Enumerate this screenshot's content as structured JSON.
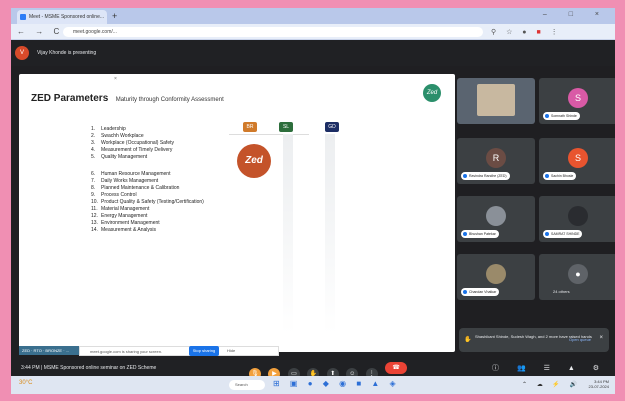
{
  "browser": {
    "tab_title": "Meet - MSME Sponsored online...",
    "new_tab": "+",
    "window_controls": "– □ ×",
    "nav": "← → C",
    "url": "meet.google.com/..."
  },
  "meet": {
    "presenter_initials": "Vijay",
    "presenting_text": "Vijay Khonde is presenting"
  },
  "slide": {
    "title": "ZED Parameters",
    "subtitle": "Maturity through Conformity Assessment",
    "logo_text": "Zed",
    "badges": [
      "BR",
      "SL",
      "GD"
    ],
    "cross": "×",
    "parameters_group1": [
      {
        "num": "1.",
        "label": "Leadership"
      },
      {
        "num": "2.",
        "label": "Swachh Workplace"
      },
      {
        "num": "3.",
        "label": "Workplace (Occupational) Safety"
      },
      {
        "num": "4.",
        "label": "Measurement of Timely Delivery"
      },
      {
        "num": "5.",
        "label": "Quality Management"
      }
    ],
    "parameters_group2": [
      {
        "num": "6.",
        "label": "Human Resource Management"
      },
      {
        "num": "7.",
        "label": "Daily Works Management"
      },
      {
        "num": "8.",
        "label": "Planned Maintenance & Calibration"
      },
      {
        "num": "9.",
        "label": "Process Control"
      },
      {
        "num": "10.",
        "label": "Product Quality & Safety (Testing/Certification)"
      },
      {
        "num": "11.",
        "label": "Material Management"
      },
      {
        "num": "12.",
        "label": "Energy Management"
      },
      {
        "num": "13.",
        "label": "Environment Management"
      },
      {
        "num": "14.",
        "label": "Measurement & Analysis"
      }
    ],
    "share_text": "meet.google.com is sharing your screen.",
    "stop_sharing": "Stop sharing",
    "hide": "Hide",
    "tag": "ZED · RTO · BRONZE · ..."
  },
  "participants": [
    {
      "name": "",
      "initial": "",
      "color": "#5a6470",
      "kind": "photo"
    },
    {
      "name": "Somnath Shinde",
      "initial": "S",
      "color": "#d95aa6",
      "kind": "avatar"
    },
    {
      "name": "Ravindra Randhe (ZED)",
      "initial": "R",
      "color": "#6b4c44",
      "kind": "avatar"
    },
    {
      "name": "Sachin Bhosle",
      "initial": "S",
      "color": "#e8542f",
      "kind": "avatar"
    },
    {
      "name": "Bhushan Patekar",
      "initial": "",
      "color": "#4a6bd1",
      "kind": "photo"
    },
    {
      "name": "SAMRAT SHINDE",
      "initial": "",
      "color": "#4a6bd1",
      "kind": "photo"
    },
    {
      "name": "Chandan Vhatkar",
      "initial": "",
      "color": "#4a6bd1",
      "kind": "photo"
    },
    {
      "name": "24 others",
      "initial": "",
      "color": "#4a6bd1",
      "kind": "others"
    }
  ],
  "notification": {
    "text": "Shashikant Shinde, Sudesh Wagh, and 2 more have raised hands",
    "open_queue": "Open queue",
    "close": "×"
  },
  "controls": {
    "time": "3:44 PM",
    "meeting_name": "MSME Sponsored online seminar on ZED Scheme",
    "end_call": "☎"
  },
  "taskbar": {
    "weather": "30°C",
    "search": "Search",
    "clock_time": "3:44 PM",
    "clock_date": "23-07-2024"
  }
}
